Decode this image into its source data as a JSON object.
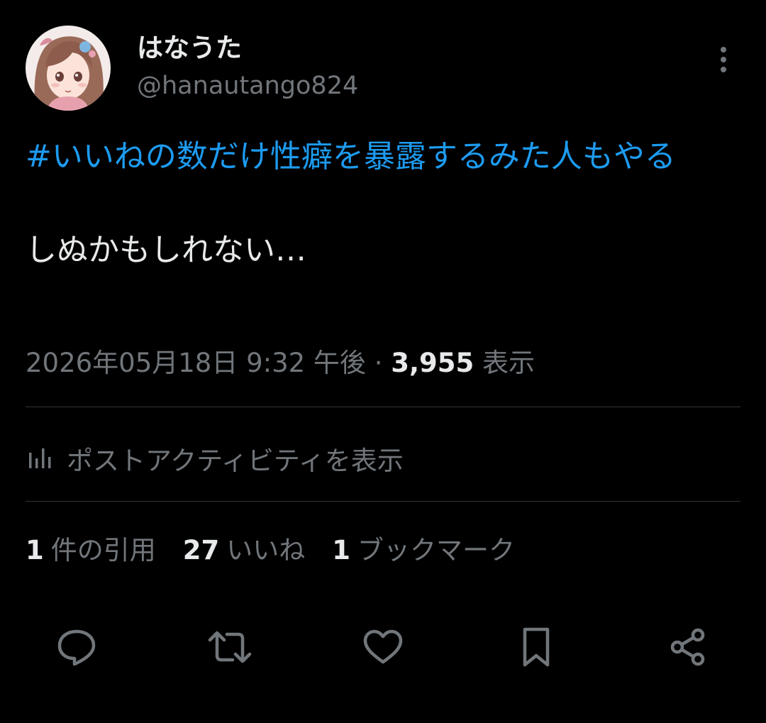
{
  "author": {
    "display_name": "はなうた",
    "handle": "@hanautango824"
  },
  "tweet": {
    "hashtag": "#いいねの数だけ性癖を暴露するみた人もやる",
    "body": "しぬかもしれない…"
  },
  "meta": {
    "timestamp": "2026年05月18日 9:32 午後",
    "separator": "·",
    "views_count": "3,955",
    "views_label": "表示"
  },
  "activity": {
    "label": "ポストアクティビティを表示",
    "icon": "bar-chart-icon"
  },
  "stats": {
    "quotes": {
      "count": "1",
      "label": "件の引用"
    },
    "likes": {
      "count": "27",
      "label": "いいね"
    },
    "bookmarks": {
      "count": "1",
      "label": "ブックマーク"
    }
  },
  "actions": {
    "icons": [
      "reply-icon",
      "retweet-icon",
      "like-icon",
      "bookmark-icon",
      "share-icon"
    ]
  },
  "colors": {
    "background": "#000000",
    "text_primary": "#e7e9ea",
    "text_secondary": "#71767b",
    "link": "#1d9bf0",
    "divider": "#2f3336"
  }
}
